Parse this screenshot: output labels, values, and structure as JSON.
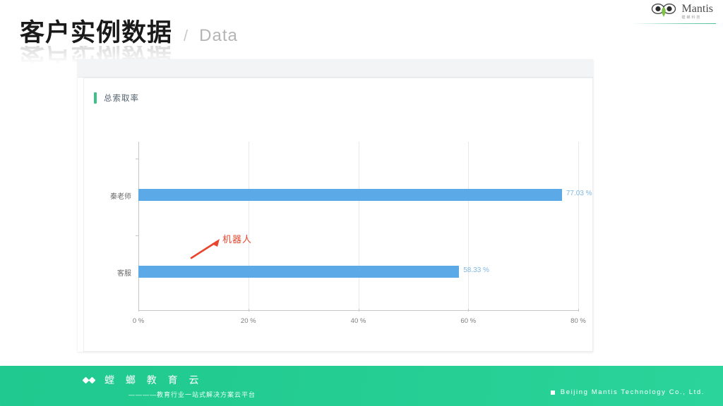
{
  "brand": {
    "name": "Mantis",
    "sub": "螳螂科技",
    "mark_icon": "mantis-head-icon"
  },
  "title": {
    "cn": "客户实例数据",
    "separator": "/",
    "en": "Data"
  },
  "screenshot": {
    "card_title": "总索取率",
    "annotation": {
      "label": "机器人",
      "color": "#e8452c",
      "arrow_icon": "arrow-up-right-icon"
    }
  },
  "chart_data": {
    "type": "bar",
    "orientation": "horizontal",
    "title": "总索取率",
    "categories": [
      "秦老师",
      "客服"
    ],
    "values": [
      77.03,
      58.33
    ],
    "value_labels": [
      "77.03 %",
      "58.33 %"
    ],
    "xlabel": "",
    "ylabel": "",
    "xlim": [
      0,
      80
    ],
    "xticks": [
      0,
      20,
      40,
      60,
      80
    ],
    "xtick_labels": [
      "0 %",
      "20 %",
      "40 %",
      "60 %",
      "80 %"
    ],
    "bar_color": "#5ba9e6",
    "value_label_color": "#7fb9e3",
    "grid": true,
    "legend": false
  },
  "footer": {
    "brand_cn": "螳 螂 教 育 云",
    "tagline": "————教育行业一站式解决方案云平台",
    "company": "Beijing  Mantis  Technology  Co.,  Ltd.",
    "bg_color": "#22cc91"
  }
}
